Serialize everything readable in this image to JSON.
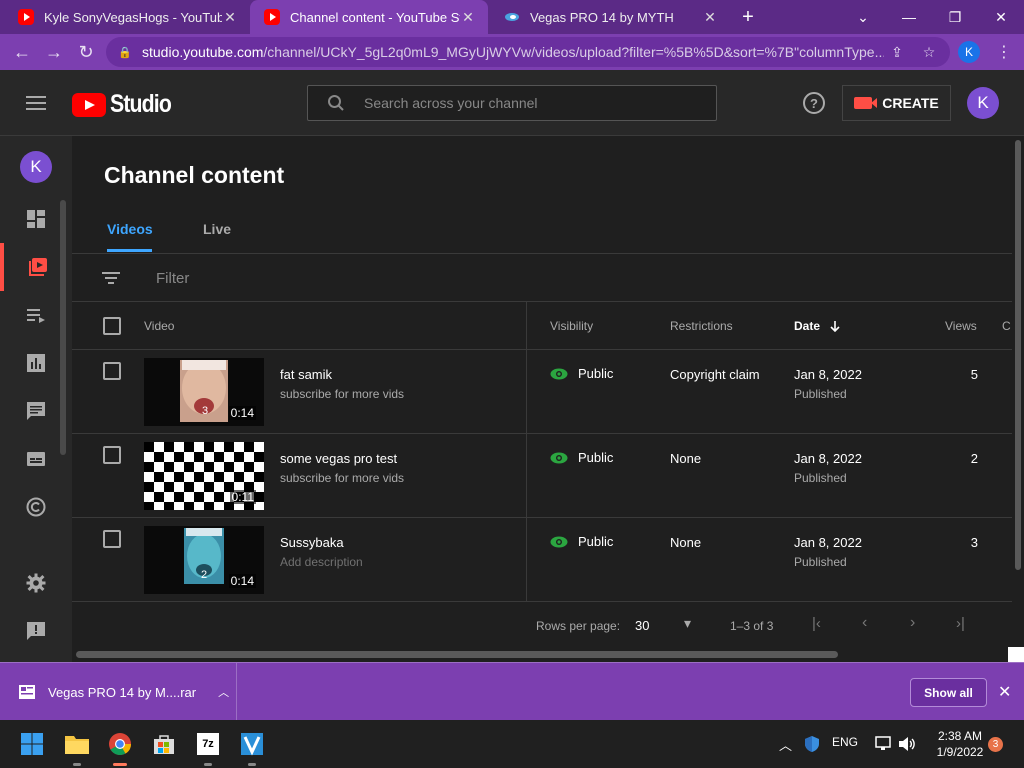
{
  "browser": {
    "tabs": [
      {
        "title": "Kyle SonyVegasHogs - YouTube",
        "active": false
      },
      {
        "title": "Channel content - YouTube Studio",
        "active": true
      },
      {
        "title": "Vegas PRO 14 by MYTH",
        "active": false
      }
    ],
    "new_tab": "+",
    "url_host": "studio.youtube.com",
    "url_path": "/channel/UCkY_5gL2q0mL9_MGyUjWYVw/videos/upload?filter=%5B%5D&sort=%7B\"columnType...",
    "profile_initial": "K"
  },
  "header": {
    "logo_word": "Studio",
    "search_placeholder": "Search across your channel",
    "help": "?",
    "create_label": "CREATE",
    "avatar_initial": "K"
  },
  "rail": {
    "avatar_initial": "K",
    "items": [
      "dashboard-icon",
      "content-icon",
      "playlists-icon",
      "analytics-icon",
      "comments-icon",
      "subtitles-icon",
      "copyright-icon",
      "settings-icon",
      "feedback-icon"
    ]
  },
  "main": {
    "title": "Channel content",
    "tabs": [
      "Videos",
      "Live"
    ],
    "filter_label": "Filter",
    "columns": [
      "Video",
      "Visibility",
      "Restrictions",
      "Date",
      "Views",
      "C"
    ],
    "rows": [
      {
        "title": "fat samik",
        "description": "subscribe for more vids",
        "duration": "0:14",
        "visibility": "Public",
        "restrictions": "Copyright claim",
        "date": "Jan 8, 2022",
        "date_status": "Published",
        "views": "5",
        "thumb_overlay": "3"
      },
      {
        "title": "some vegas pro test",
        "description": "subscribe for more vids",
        "duration": "0:11",
        "visibility": "Public",
        "restrictions": "None",
        "date": "Jan 8, 2022",
        "date_status": "Published",
        "views": "2",
        "thumb_overlay": ""
      },
      {
        "title": "Sussybaka",
        "description": "Add description",
        "duration": "0:14",
        "visibility": "Public",
        "restrictions": "None",
        "date": "Jan 8, 2022",
        "date_status": "Published",
        "views": "3",
        "thumb_overlay": "2"
      }
    ],
    "pager": {
      "rows_label": "Rows per page:",
      "rows_value": "30",
      "range": "1–3 of 3"
    }
  },
  "download_bar": {
    "file_name": "Vegas PRO 14 by M....rar",
    "show_all": "Show all"
  },
  "taskbar": {
    "language": "ENG",
    "time": "2:38 AM",
    "date": "1/9/2022",
    "notifications": "3",
    "zip_label": "7z"
  },
  "colors": {
    "accent_blue": "#3ea6ff",
    "youtube_red": "#ff0000",
    "browser_purple": "#7c3fb0",
    "public_green": "#2ba640"
  }
}
